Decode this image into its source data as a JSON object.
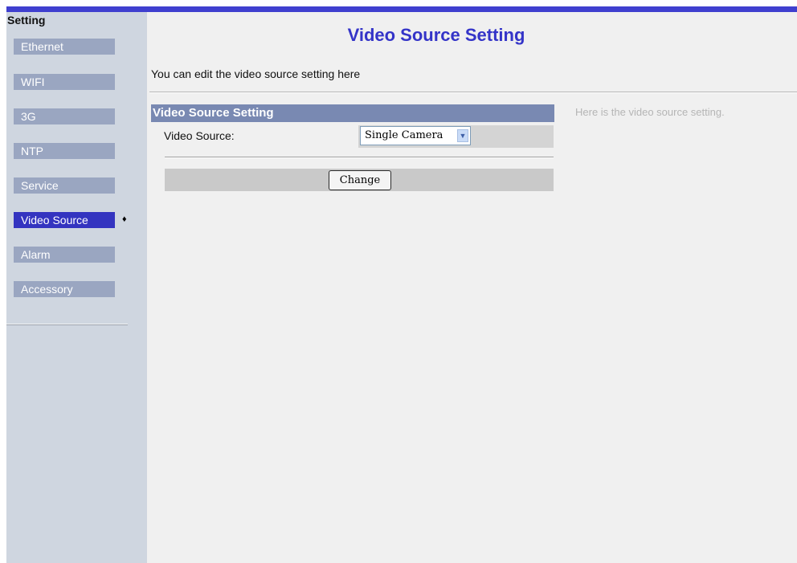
{
  "sidebar": {
    "title": "Setting",
    "items": [
      {
        "label": "Ethernet",
        "active": false
      },
      {
        "label": "WIFI",
        "active": false
      },
      {
        "label": "3G",
        "active": false
      },
      {
        "label": "NTP",
        "active": false
      },
      {
        "label": "Service",
        "active": false
      },
      {
        "label": "Video Source",
        "active": true
      },
      {
        "label": "Alarm",
        "active": false
      },
      {
        "label": "Accessory",
        "active": false
      }
    ],
    "active_marker": "♦"
  },
  "main": {
    "title": "Video Source Setting",
    "intro": "You can edit the video source setting here",
    "section_title": "Video Source Setting",
    "help_text": "Here is the video source setting.",
    "form": {
      "video_source_label": "Video Source:",
      "video_source_value": "Single Camera",
      "change_button": "Change"
    }
  },
  "colors": {
    "accent": "#3434c8",
    "nav_inactive": "#9aa6c1",
    "nav_active": "#3434c0",
    "section_header": "#7989b2"
  },
  "icons": {
    "select_arrow": "chevron-down-icon",
    "active_marker": "diamond-icon"
  }
}
